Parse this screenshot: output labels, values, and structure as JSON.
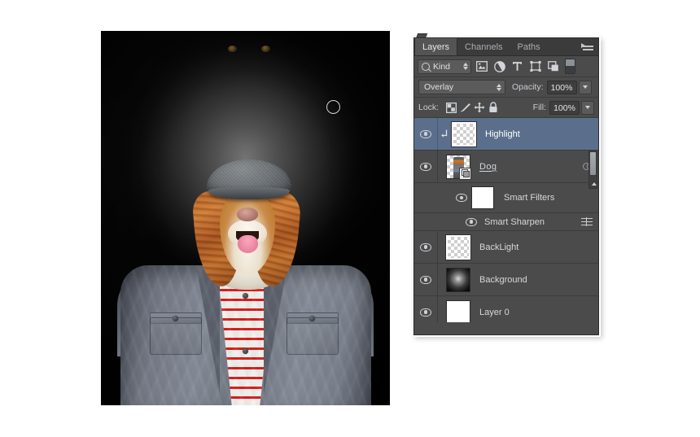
{
  "app": {
    "name": "Adobe Photoshop",
    "panel_title": "Layers"
  },
  "canvas": {
    "document_description": "Composite photo of a cocker spaniel head on a human body wearing a gray flat cap, gray jacket and red-white striped shirt, on a dark studio vignette background",
    "brush_cursor": "brush-cursor-ring"
  },
  "panel": {
    "tabs": [
      {
        "label": "Layers",
        "active": true
      },
      {
        "label": "Channels",
        "active": false
      },
      {
        "label": "Paths",
        "active": false
      }
    ],
    "menu_icon": "panel-menu-icon",
    "filter": {
      "kind_label": "Kind",
      "search_icon": "search-icon",
      "icons": [
        "pixel-layer-filter-icon",
        "adjustment-layer-filter-icon",
        "type-layer-filter-icon",
        "shape-layer-filter-icon",
        "smart-object-filter-icon"
      ],
      "toggle": "filter-enable-toggle"
    },
    "blend": {
      "mode": "Overlay",
      "opacity_label": "Opacity:",
      "opacity_value": "100%"
    },
    "lock": {
      "label": "Lock:",
      "icons": [
        "lock-transparent-pixels-icon",
        "lock-image-pixels-icon",
        "lock-position-icon",
        "lock-all-icon"
      ],
      "fill_label": "Fill:",
      "fill_value": "100%"
    },
    "layers": [
      {
        "name": "Highlight",
        "visible": true,
        "selected": true,
        "thumb": "checker",
        "clipping_mask": true
      },
      {
        "name": "Dog",
        "visible": true,
        "selected": false,
        "thumb": "photo",
        "smart_object": true,
        "underlined": true,
        "has_fx": true
      },
      {
        "name": "Smart Filters",
        "visible": true,
        "selected": false,
        "thumb": "white",
        "is_sub": true
      },
      {
        "name": "Smart Sharpen",
        "visible": true,
        "selected": false,
        "is_filter_item": true,
        "settings_icon": "filter-settings-icon"
      },
      {
        "name": "BackLight",
        "visible": true,
        "selected": false,
        "thumb": "checker"
      },
      {
        "name": "Background",
        "visible": true,
        "selected": false,
        "thumb": "radial"
      },
      {
        "name": "Layer 0",
        "visible": true,
        "selected": false,
        "thumb": "white"
      }
    ],
    "scrollbar": "layer-list-scrollbar"
  },
  "colors": {
    "panel_bg": "#4b4b4b",
    "panel_tab_bg": "#3b3b3b",
    "selected_layer": "#5b6f8c",
    "accent": "#e0622a",
    "text": "#d5d8dc"
  }
}
